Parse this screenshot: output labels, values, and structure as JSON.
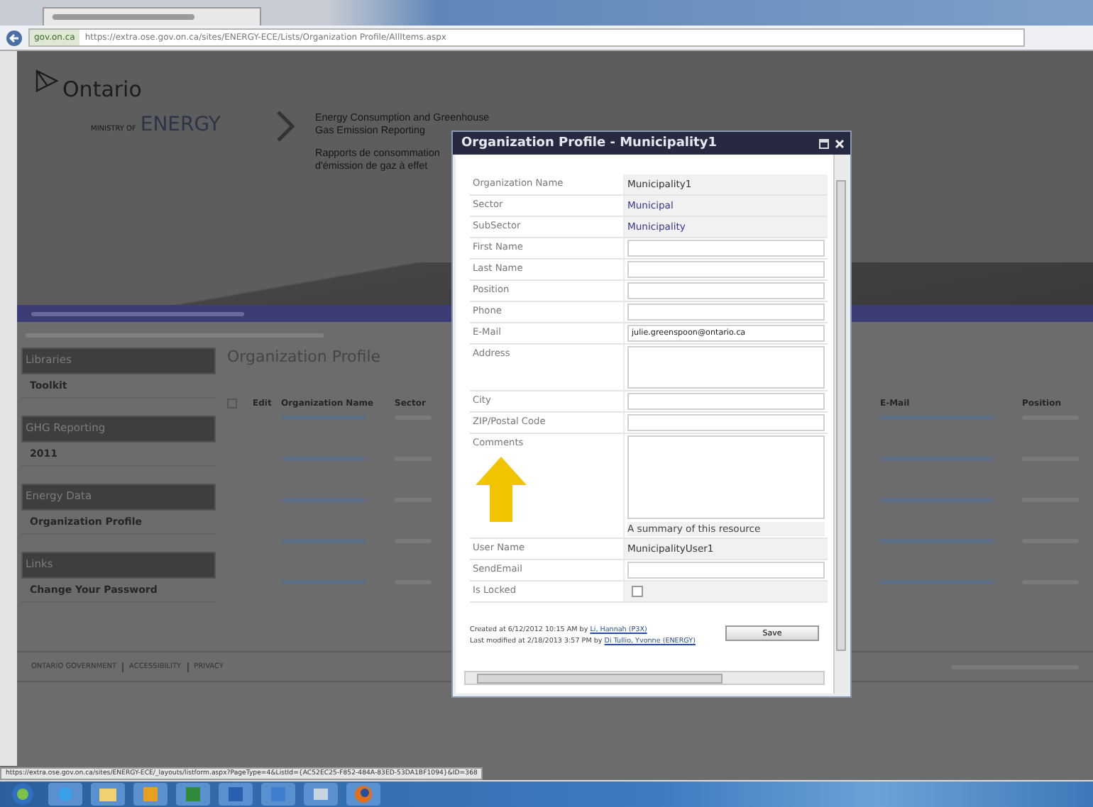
{
  "browser": {
    "address_site": "gov.on.ca",
    "address": "https://extra.ose.gov.on.ca/sites/ENERGY-ECE/Lists/Organization Profile/AllItems.aspx",
    "status_url": "https://extra.ose.gov.on.ca/sites/ENERGY-ECE/_layouts/listform.aspx?PageType=4&ListId={AC52EC25-F852-484A-83ED-53DA1BF1094}&ID=368"
  },
  "header": {
    "logo": "Ontario",
    "ministry_prefix": "MINISTRY OF",
    "ministry": "ENERGY",
    "title_en": [
      "Energy Consumption and Greenhouse",
      "Gas Emission Reporting"
    ],
    "title_fr": [
      "Rapports de consommation",
      "d'émission de gaz à effet"
    ]
  },
  "sidebar": [
    {
      "heading": "Libraries",
      "items": [
        "Toolkit"
      ]
    },
    {
      "heading": "GHG Reporting",
      "items": [
        "2011"
      ]
    },
    {
      "heading": "Energy Data",
      "items": [
        "Organization Profile"
      ]
    },
    {
      "heading": "Links",
      "items": [
        "Change Your Password"
      ]
    }
  ],
  "main": {
    "heading": "Organization Profile",
    "columns": [
      "Edit",
      "Organization Name",
      "Sector"
    ],
    "right_columns": [
      "E-Mail",
      "Position"
    ]
  },
  "footer_links": [
    "ONTARIO GOVERNMENT",
    "ACCESSIBILITY",
    "PRIVACY"
  ],
  "dialog": {
    "title": "Organization Profile - Municipality1",
    "fields": [
      {
        "kind": "display",
        "label": "Organization Name",
        "value": "Municipality1"
      },
      {
        "kind": "link",
        "label": "Sector",
        "value": "Municipal"
      },
      {
        "kind": "link",
        "label": "SubSector",
        "value": "Municipality"
      },
      {
        "kind": "input",
        "label": "First Name"
      },
      {
        "kind": "input",
        "label": "Last Name"
      },
      {
        "kind": "input",
        "label": "Position"
      },
      {
        "kind": "input",
        "label": "Phone"
      },
      {
        "kind": "input",
        "label": "E-Mail",
        "value": "julie.greenspoon@ontario.ca"
      },
      {
        "kind": "textarea",
        "label": "Address"
      },
      {
        "kind": "input",
        "label": "City"
      },
      {
        "kind": "input",
        "label": "ZIP/Postal Code"
      },
      {
        "kind": "textarea",
        "label": "Comments",
        "tall": true,
        "note": "A summary of this resource",
        "annotated": true
      },
      {
        "kind": "display",
        "label": "User Name",
        "value": "MunicipalityUser1"
      },
      {
        "kind": "input",
        "label": "SendEmail"
      },
      {
        "kind": "checkbox",
        "label": "Is Locked",
        "checked": false
      }
    ],
    "created_prefix": "Created at 6/12/2012 10:15 AM by",
    "created_by": "Li, Hannah (P3X)",
    "modified_prefix": "Last modified at 2/18/2013 3:57 PM by",
    "modified_by": "Di Tullio, Yvonne (ENERGY)",
    "save": "Save"
  }
}
